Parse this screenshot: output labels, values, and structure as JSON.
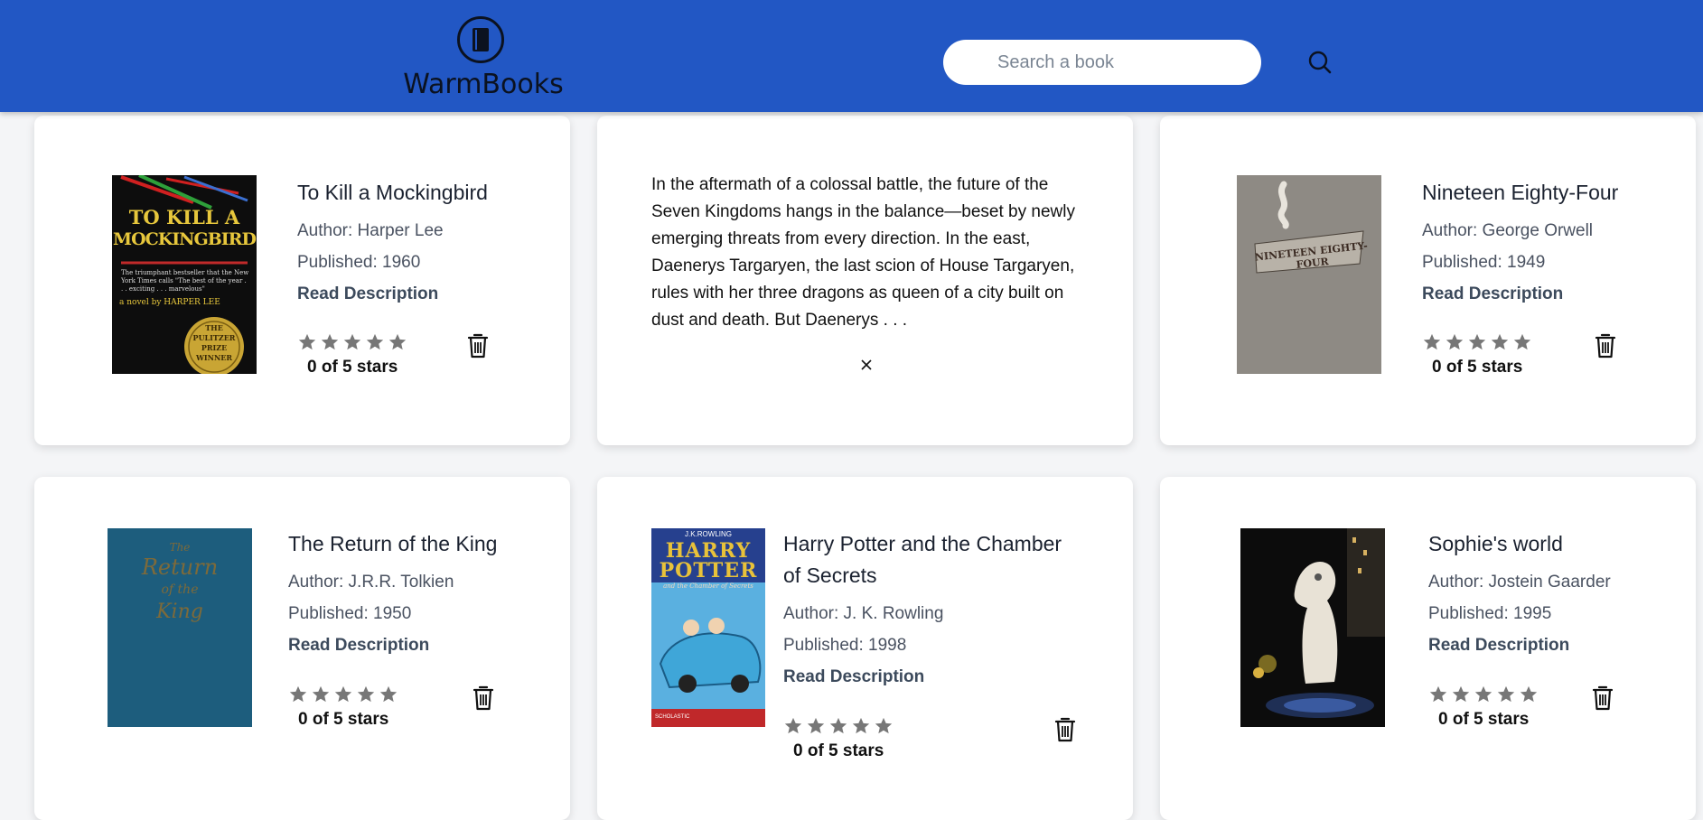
{
  "header": {
    "logo_text": "WarmBooks",
    "search_placeholder": "Search a book",
    "search_value": "",
    "brand_color": "#2257c4"
  },
  "books": [
    {
      "title": "To Kill a Mockingbird",
      "author": "Author: Harper Lee",
      "published": "Published: 1960",
      "read_label": "Read Description",
      "rating_text": "0 of 5 stars",
      "rating": 0,
      "cover": {
        "line1": "TO KILL A",
        "line2": "MOCKINGBIRD",
        "blurb": "The triumphant bestseller that the New York Times calls \"The best of the year . . . exciting . . . marvelous\"",
        "byline": "a novel by HARPER LEE",
        "seal": [
          "THE",
          "PULITZER",
          "PRIZE",
          "WINNER"
        ]
      }
    },
    {
      "description": "In the aftermath of a colossal battle, the future of the Seven Kingdoms hangs in the balance—beset by newly emerging threats from every direction. In the east, Daenerys Targaryen, the last scion of House Targaryen, rules with her three dragons as queen of a city built on dust and death. But Daenerys . . ."
    },
    {
      "title": "Nineteen Eighty-Four",
      "author": "Author: George Orwell",
      "published": "Published: 1949",
      "read_label": "Read Description",
      "rating_text": "0 of 5 stars",
      "rating": 0,
      "cover": {
        "label": "NINETEEN EIGHTY-FOUR"
      }
    },
    {
      "title": "The Return of the King",
      "author": "Author: J.R.R. Tolkien",
      "published": "Published: 1950",
      "read_label": "Read Description",
      "rating_text": "0 of 5 stars",
      "rating": 0,
      "cover": {
        "line1": "The",
        "line2": "Return",
        "line3": "of the",
        "line4": "King"
      }
    },
    {
      "title_line1": "Harry Potter and the Chamber",
      "title_line2": "of Secrets",
      "author": "Author: J. K. Rowling",
      "published": "Published: 1998",
      "read_label": "Read Description",
      "rating_text": "0 of 5 stars",
      "rating": 0,
      "cover": {
        "author": "J.K.ROWLING",
        "line1": "HARRY",
        "line2": "POTTER",
        "subtitle": "and the Chamber of Secrets",
        "publisher": "SCHOLASTIC"
      }
    },
    {
      "title": "Sophie's world",
      "author": "Author: Jostein Gaarder",
      "published": "Published: 1995",
      "read_label": "Read Description",
      "rating_text": "0 of 5 stars",
      "rating": 0,
      "cover": {}
    }
  ]
}
